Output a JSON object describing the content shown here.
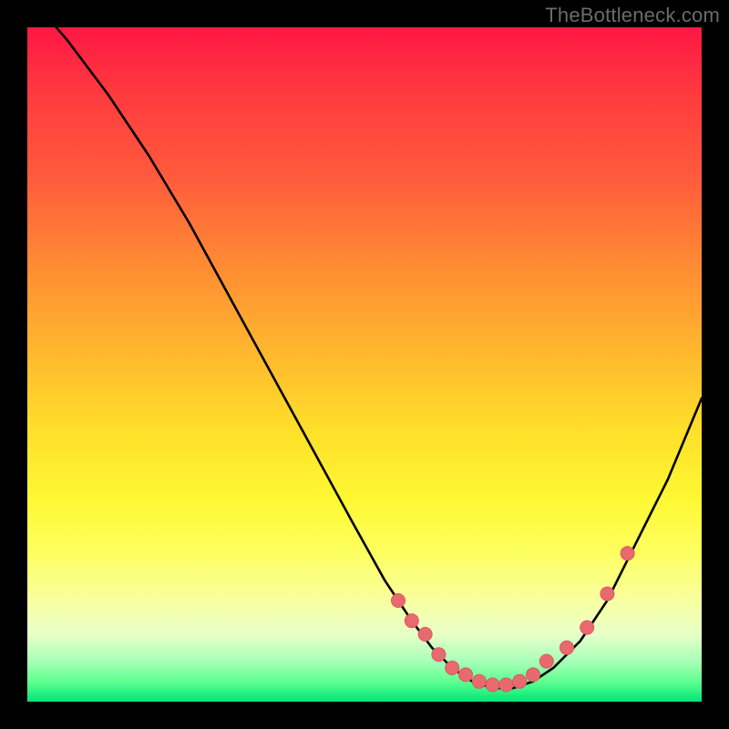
{
  "watermark": "TheBottleneck.com",
  "colors": {
    "background": "#000000",
    "curve_stroke": "#000000",
    "marker_fill": "#e86a6f",
    "marker_stroke": "#d85a60",
    "gradient_top": "#ff1744",
    "gradient_bottom": "#00e676"
  },
  "chart_data": {
    "type": "line",
    "title": "",
    "xlabel": "",
    "ylabel": "",
    "xlim": [
      0,
      100
    ],
    "ylim": [
      0,
      100
    ],
    "grid": false,
    "legend": false,
    "series": [
      {
        "name": "bottleneck-curve",
        "x": [
          0,
          6,
          12,
          18,
          24,
          30,
          36,
          42,
          48,
          53,
          57,
          60,
          63,
          66,
          69,
          72,
          75,
          78,
          82,
          86,
          90,
          95,
          100
        ],
        "values": [
          105,
          98,
          90,
          81,
          71,
          60,
          49,
          38,
          27,
          18,
          12,
          8,
          5,
          3,
          2,
          2,
          3,
          5,
          9,
          15,
          23,
          33,
          45
        ]
      }
    ],
    "markers": {
      "name": "highlighted-points",
      "x": [
        55,
        57,
        59,
        61,
        63,
        65,
        67,
        69,
        71,
        73,
        75,
        77,
        80,
        83,
        86,
        89
      ],
      "values": [
        15,
        12,
        10,
        7,
        5,
        4,
        3,
        2.5,
        2.5,
        3,
        4,
        6,
        8,
        11,
        16,
        22
      ]
    }
  }
}
